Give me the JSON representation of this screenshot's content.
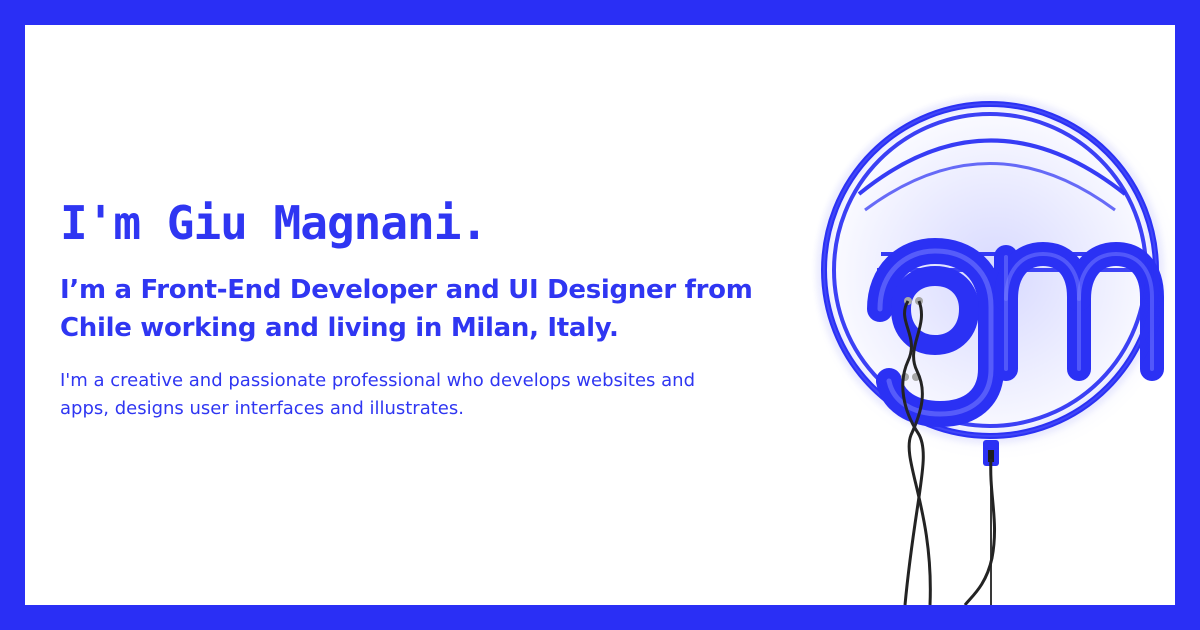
{
  "colors": {
    "brand": "#2a2ff5",
    "text": "#2f36f2",
    "background": "#ffffff",
    "wire": "#232323"
  },
  "hero": {
    "headline": "I'm Giu Magnani.",
    "subheadline": "I’m a Front-End Developer and UI Designer from Chile working and living in Milan, Italy.",
    "description": "I'm a creative and passionate professional who develops websites and apps, designs user interfaces and illustrates."
  },
  "logo": {
    "text": "gm",
    "icon": "neon-gm-logo-icon"
  }
}
